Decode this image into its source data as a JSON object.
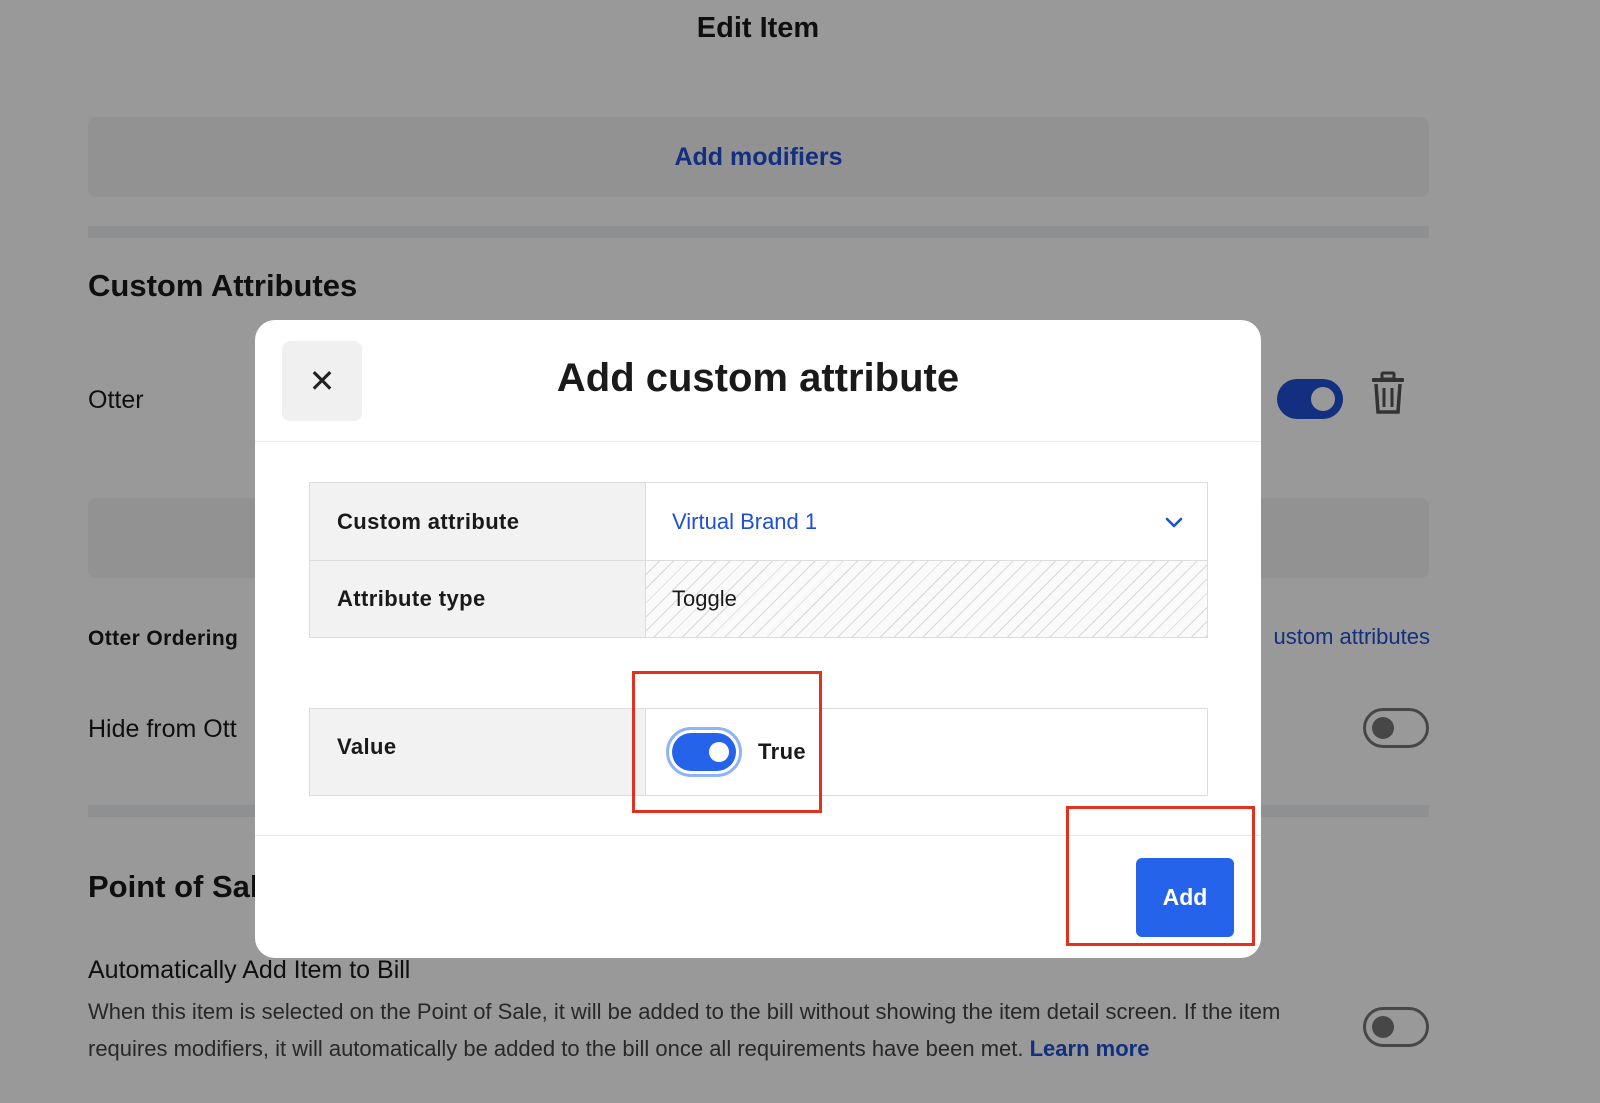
{
  "page": {
    "title": "Edit Item",
    "add_modifiers": "Add modifiers",
    "custom_attributes_heading": "Custom Attributes",
    "otter_label": "Otter",
    "otter_ordering_label": "Otter Ordering",
    "manage_link": "ustom attributes",
    "hide_label": "Hide from Ott",
    "pos_heading": "Point of Sale",
    "auto_add_label": "Automatically Add Item to Bill",
    "auto_add_desc": "When this item is selected on the Point of Sale, it will be added to the bill without showing the item detail screen. If the item requires modifiers, it will automatically be added to the bill once all requirements have been met.",
    "learn_more": "Learn more"
  },
  "modal": {
    "title": "Add custom attribute",
    "close_icon": "close-icon",
    "fields": [
      {
        "label": "Custom attribute",
        "value": "Virtual Brand 1"
      },
      {
        "label": "Attribute type",
        "value": "Toggle"
      }
    ],
    "value_label": "Value",
    "value_toggle": {
      "state": true,
      "label": "True"
    },
    "add_button": "Add"
  },
  "colors": {
    "accent": "#2563eb",
    "link": "#1f4fd6",
    "highlight": "#e0321f"
  }
}
